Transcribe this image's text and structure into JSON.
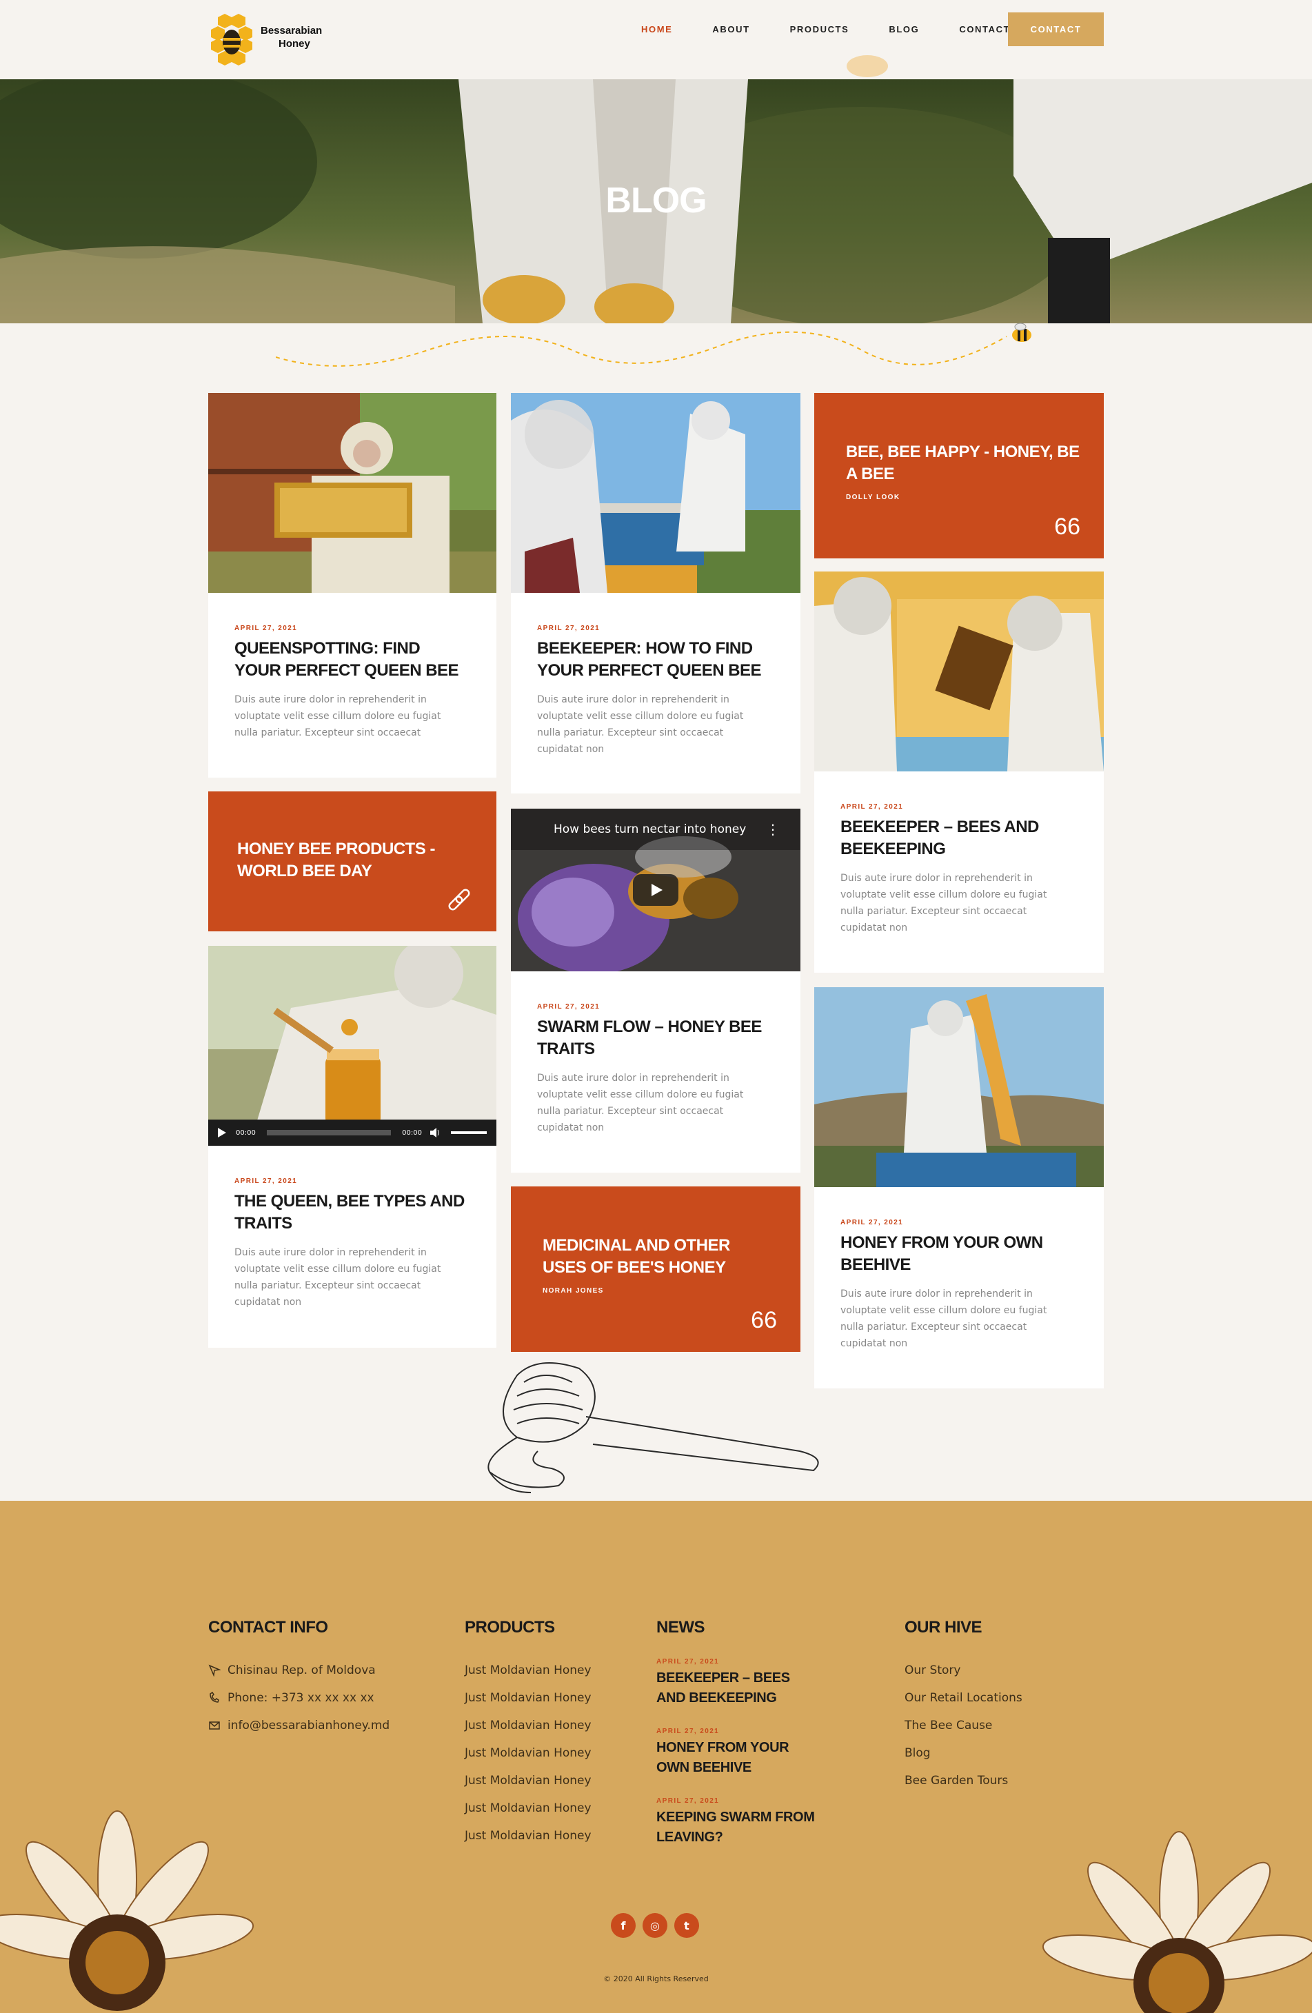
{
  "header": {
    "logo_line1": "Bessarabian",
    "logo_line2": "Honey",
    "nav": [
      "HOME",
      "ABOUT",
      "PRODUCTS",
      "BLOG",
      "CONTACT"
    ],
    "cta": "CONTACT"
  },
  "hero": {
    "title": "BLOG"
  },
  "posts": {
    "p1": {
      "date": "APRIL 27, 2021",
      "title": "QUEENSPOTTING: FIND YOUR PERFECT QUEEN BEE",
      "excerpt": "Duis aute irure dolor in reprehenderit in voluptate velit esse cillum dolore eu fugiat nulla pariatur. Excepteur sint occaecat"
    },
    "p2": {
      "date": "APRIL 27, 2021",
      "title": "BEEKEEPER: HOW TO FIND YOUR PERFECT QUEEN BEE",
      "excerpt": "Duis aute irure dolor in reprehenderit in voluptate velit esse cillum dolore eu fugiat nulla pariatur. Excepteur sint occaecat cupidatat non"
    },
    "q1": {
      "title": "BEE, BEE HAPPY - HONEY, BE A BEE",
      "author": "DOLLY LOOK",
      "mark": "66"
    },
    "p3": {
      "date": "APRIL 27, 2021",
      "title": "BEEKEEPER – BEES AND BEEKEEPING",
      "excerpt": "Duis aute irure dolor in reprehenderit in voluptate velit esse cillum dolore eu fugiat nulla pariatur. Excepteur sint occaecat cupidatat non"
    },
    "link1": {
      "title": "HONEY BEE PRODUCTS - WORLD BEE DAY"
    },
    "video": {
      "caption": "How bees turn nectar into honey"
    },
    "p4": {
      "date": "APRIL 27, 2021",
      "title": "SWARM FLOW – HONEY BEE TRAITS",
      "excerpt": "Duis aute irure dolor in reprehenderit in voluptate velit esse cillum dolore eu fugiat nulla pariatur. Excepteur sint occaecat cupidatat non"
    },
    "audio": {
      "current": "00:00",
      "duration": "00:00"
    },
    "p5": {
      "date": "APRIL 27, 2021",
      "title": "THE QUEEN, BEE TYPES AND TRAITS",
      "excerpt": "Duis aute irure dolor in reprehenderit in voluptate velit esse cillum dolore eu fugiat nulla pariatur. Excepteur sint occaecat cupidatat non"
    },
    "p6": {
      "date": "APRIL 27, 2021",
      "title": "HONEY FROM YOUR OWN BEEHIVE",
      "excerpt": "Duis aute irure dolor in reprehenderit in voluptate velit esse cillum dolore eu fugiat nulla pariatur. Excepteur sint occaecat cupidatat non"
    },
    "q2": {
      "title": "MEDICINAL AND OTHER USES OF BEE'S HONEY",
      "author": "NORAH JONES",
      "mark": "66"
    }
  },
  "footer": {
    "contact": {
      "heading": "CONTACT INFO",
      "address": "Chisinau Rep. of Moldova",
      "phone": "Phone: +373 xx xx xx xx",
      "email": "info@bessarabianhoney.md"
    },
    "products": {
      "heading": "PRODUCTS",
      "items": [
        "Just Moldavian Honey",
        "Just Moldavian Honey",
        "Just Moldavian Honey",
        "Just Moldavian Honey",
        "Just Moldavian Honey",
        "Just Moldavian Honey",
        "Just Moldavian Honey"
      ]
    },
    "news": {
      "heading": "NEWS",
      "items": [
        {
          "date": "APRIL 27, 2021",
          "title": "BEEKEEPER – BEES AND BEEKEEPING"
        },
        {
          "date": "APRIL 27, 2021",
          "title": "HONEY FROM YOUR OWN BEEHIVE"
        },
        {
          "date": "APRIL 27, 2021",
          "title": "KEEPING SWARM FROM LEAVING?"
        }
      ]
    },
    "hive": {
      "heading": "OUR HIVE",
      "items": [
        "Our Story",
        "Our Retail Locations",
        "The Bee Cause",
        "Blog",
        "Bee Garden Tours"
      ]
    },
    "social": [
      "f",
      "◎",
      "t"
    ],
    "copyright": "© 2020 All Rights Reserved"
  }
}
